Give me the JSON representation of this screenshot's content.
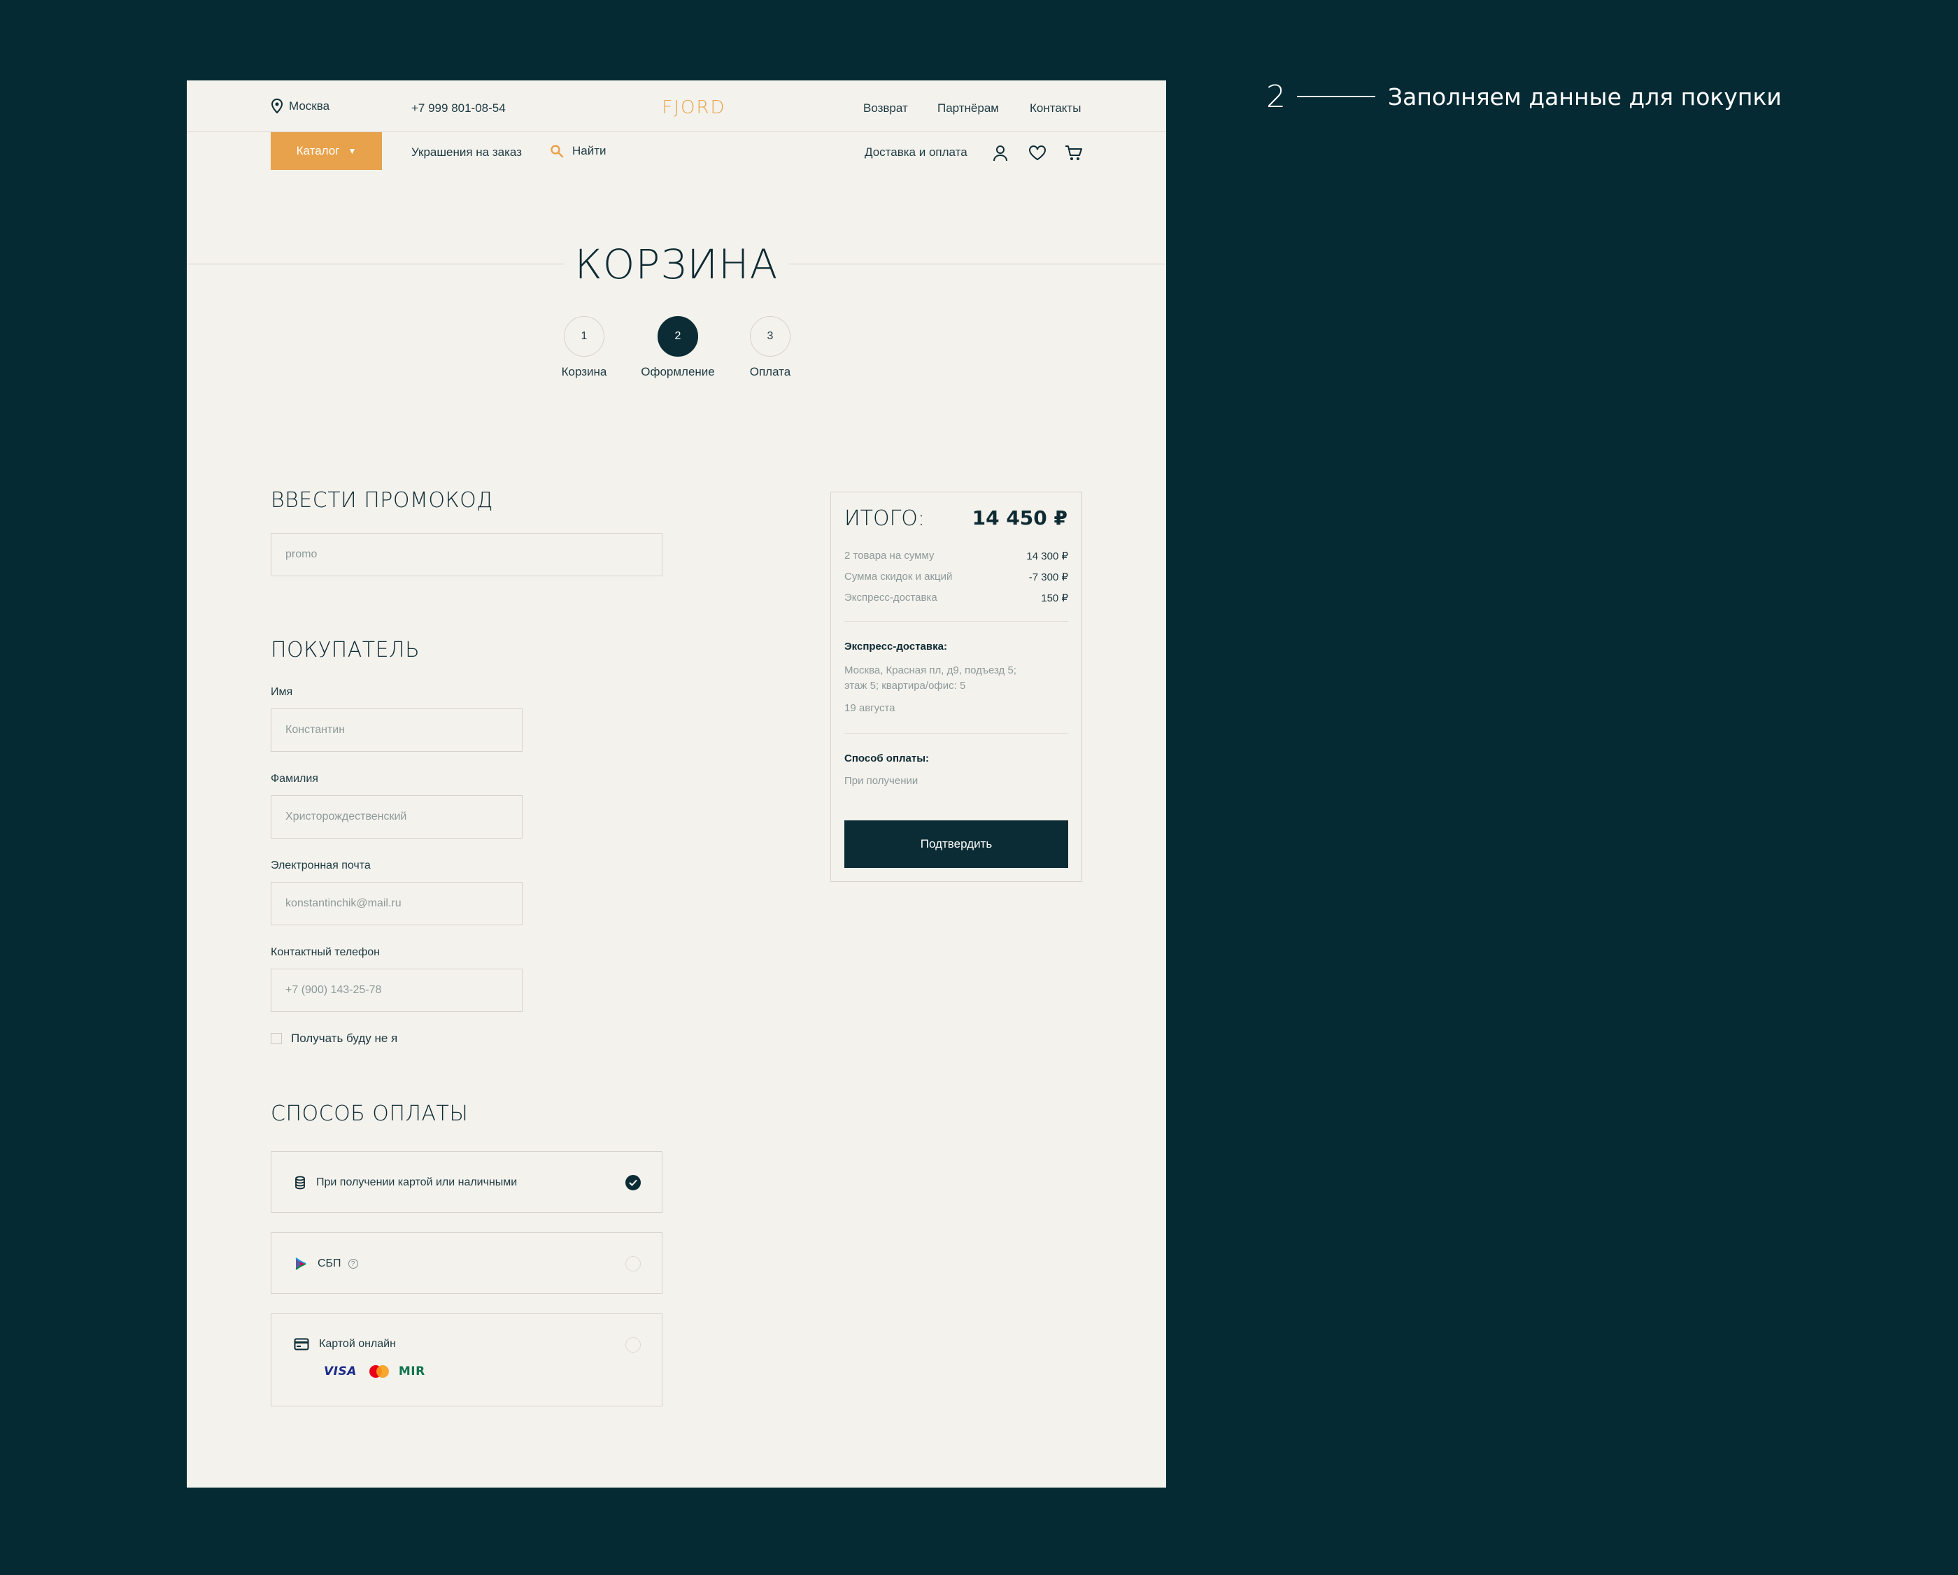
{
  "annotation": {
    "number": "2",
    "text": "Заполняем данные для покупки"
  },
  "header": {
    "city": "Москва",
    "phone": "+7 999 801-08-54",
    "logo": "FJORD",
    "nav": [
      "Возврат",
      "Партнёрам",
      "Контакты"
    ],
    "catalog": "Каталог",
    "custom_jewelry": "Украшения на заказ",
    "search": "Найти",
    "delivery": "Доставка и оплата",
    "icons": [
      "user-icon",
      "heart-icon",
      "cart-icon"
    ]
  },
  "page_title": "КОРЗИНА",
  "steps": [
    {
      "num": "1",
      "label": "Корзина"
    },
    {
      "num": "2",
      "label": "Оформление"
    },
    {
      "num": "3",
      "label": "Оплата"
    }
  ],
  "active_step": 2,
  "promo": {
    "title": "ВВЕСТИ ПРОМОКОД",
    "placeholder": "promo"
  },
  "buyer": {
    "title": "ПОКУПАТЕЛЬ",
    "name_label": "Имя",
    "name_placeholder": "Константин",
    "surname_label": "Фамилия",
    "surname_placeholder": "Христорождественский",
    "email_label": "Электронная почта",
    "email_placeholder": "konstantinchik@mail.ru",
    "phone_label": "Контактный телефон",
    "phone_placeholder": "+7 (900) 143-25-78",
    "checkbox_label": "Получать буду не я"
  },
  "payment": {
    "title": "СПОСОБ ОПЛАТЫ",
    "options": [
      {
        "label": "При получении картой или наличными",
        "selected": true
      },
      {
        "label": "СБП",
        "selected": false
      },
      {
        "label": "Картой онлайн",
        "selected": false
      }
    ],
    "card_brands": [
      "VISA",
      "MIR"
    ]
  },
  "summary": {
    "total_label": "ИТОГО:",
    "total_value": "14 450  ₽",
    "rows": [
      {
        "k": "2 товара на сумму",
        "v": "14 300  ₽"
      },
      {
        "k": "Сумма скидок и акций",
        "v": "-7 300  ₽"
      },
      {
        "k": "Экспресс-доставка",
        "v": "150  ₽"
      }
    ],
    "delivery_title": "Экспресс-доставка:",
    "delivery_addr1": "Москва, Красная пл, д9, подъезд 5;",
    "delivery_addr2": "этаж 5; квартира/офис: 5",
    "delivery_date": "19 августа",
    "payment_title": "Способ оплаты:",
    "payment_text": "При получении",
    "confirm": "Подтвердить"
  },
  "colors": {
    "accent": "#e8a24b",
    "dark": "#0b2c35",
    "page_bg": "#f4f2ed",
    "outer_bg": "#052a34"
  }
}
